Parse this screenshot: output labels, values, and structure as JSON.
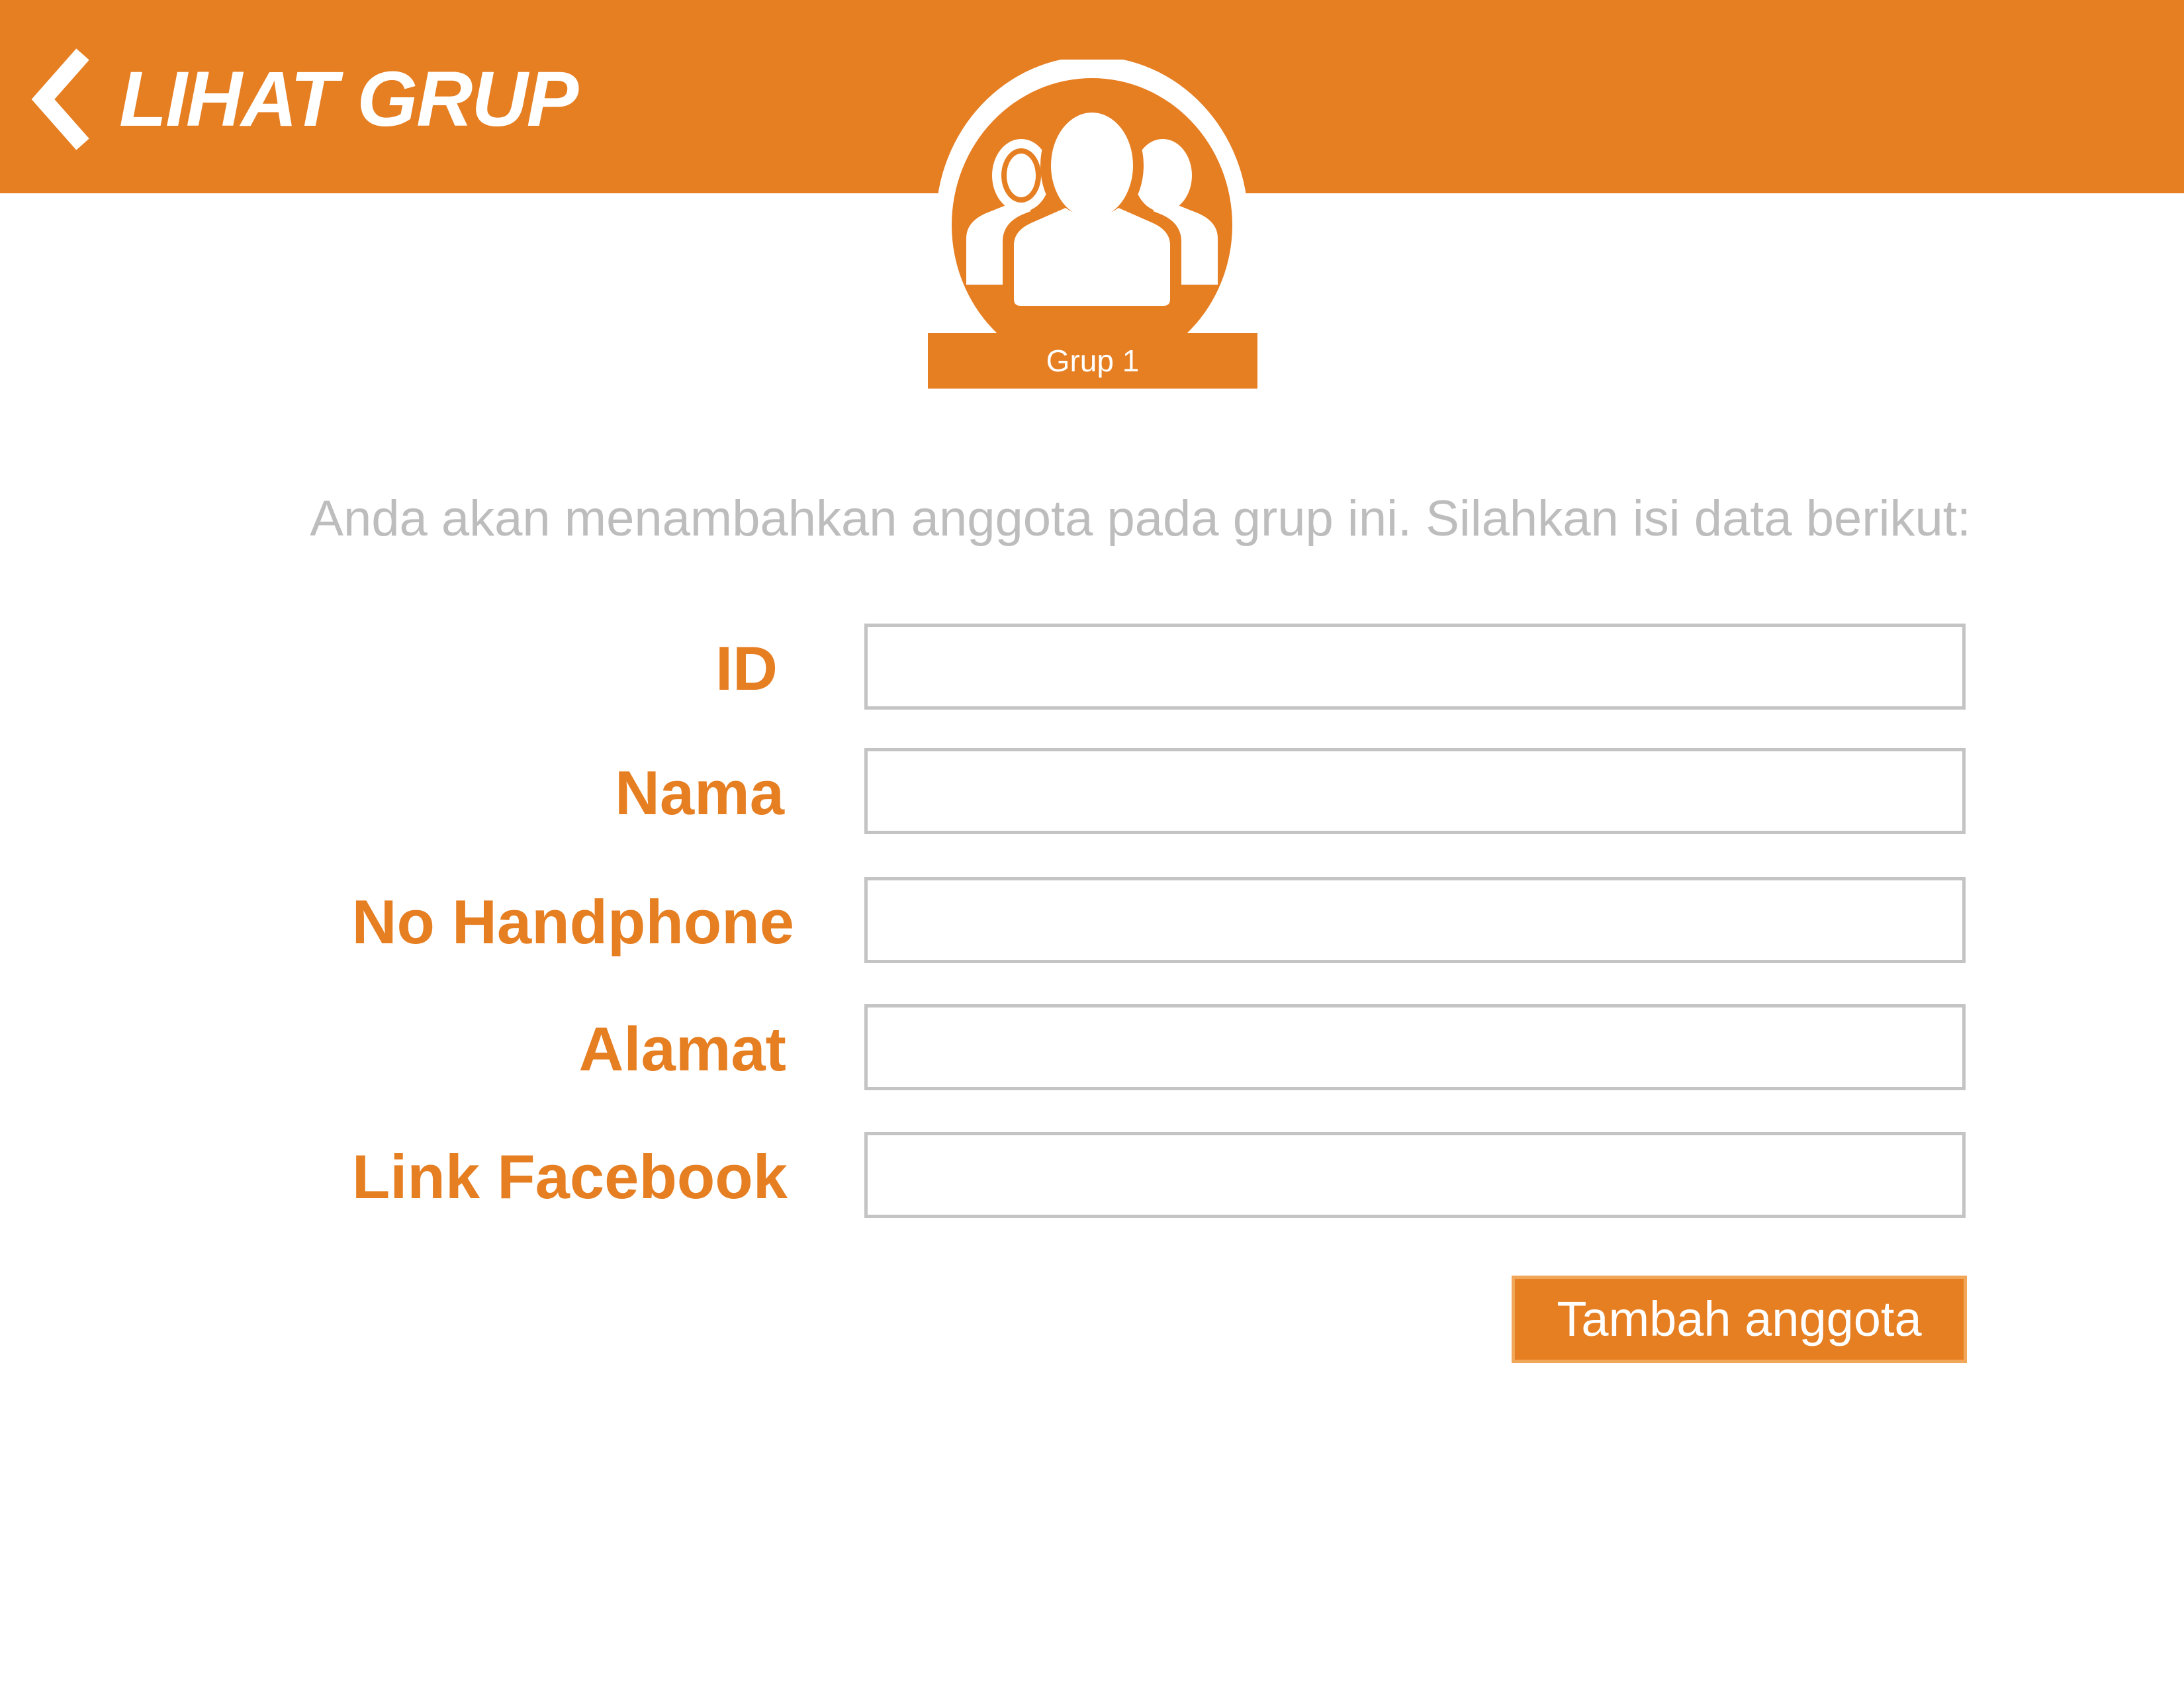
{
  "header": {
    "back_icon": "chevron-left-icon",
    "title": "LIHAT GRUP"
  },
  "group": {
    "avatar_icon": "group-users-icon",
    "name": "Grup 1"
  },
  "instruction": "Anda akan menambahkan anggota pada grup ini. Silahkan isi data berikut:",
  "form": {
    "fields": [
      {
        "label": "ID",
        "value": ""
      },
      {
        "label": "Nama",
        "value": ""
      },
      {
        "label": "No Handphone",
        "value": ""
      },
      {
        "label": "Alamat",
        "value": ""
      },
      {
        "label": "Link Facebook",
        "value": ""
      }
    ],
    "submit_label": "Tambah anggota"
  },
  "colors": {
    "accent": "#E67E22",
    "input_border": "#c4c4c4",
    "instruction_text": "#bdbdbd",
    "background": "#ffffff"
  }
}
